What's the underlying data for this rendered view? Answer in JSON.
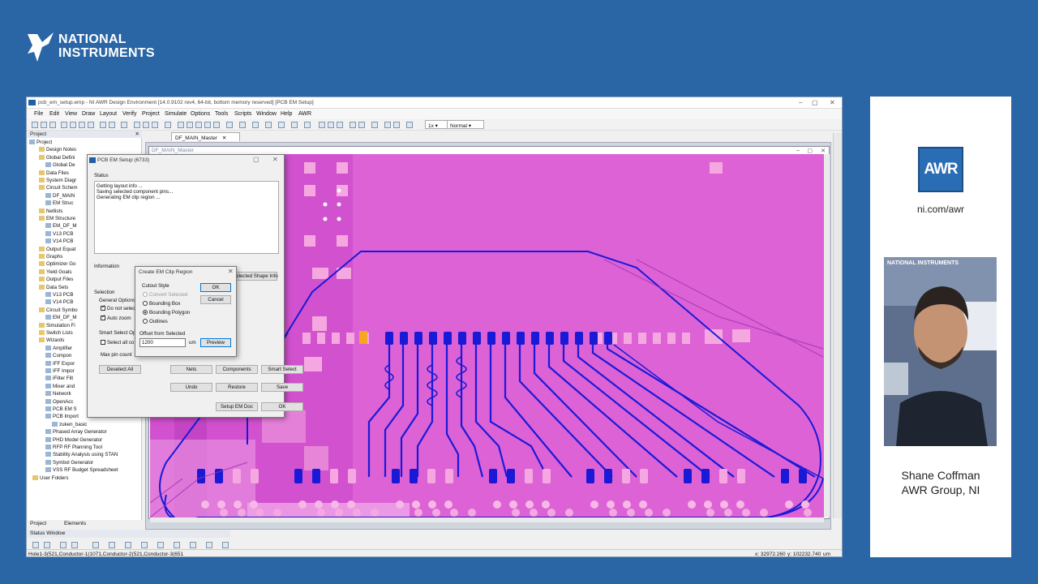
{
  "brand": {
    "line1": "NATIONAL",
    "line2": "INSTRUMENTS"
  },
  "window": {
    "title": "pcb_em_setup.emp - NI AWR Design Environment [14.0.9102 rev4, 64-bit, bottom memory reserved] [PCB EM Setup]",
    "controls": [
      "–",
      "▢",
      "✕"
    ]
  },
  "menu": [
    "File",
    "Edit",
    "View",
    "Draw",
    "Layout",
    "Verify",
    "Project",
    "Simulate",
    "Options",
    "Tools",
    "Scripts",
    "Window",
    "Help",
    "AWR"
  ],
  "toolbar": {
    "zoom": "1x",
    "mode": "Normal"
  },
  "project_pane": {
    "title": "Project",
    "items": [
      {
        "label": "Project",
        "icon": "d"
      },
      {
        "label": "Design Notes",
        "icon": "f"
      },
      {
        "label": "Global Defini",
        "icon": "f"
      },
      {
        "label": "Global De",
        "icon": "d"
      },
      {
        "label": "Data Files",
        "icon": "f"
      },
      {
        "label": "System Diagr",
        "icon": "f"
      },
      {
        "label": "Circuit Schem",
        "icon": "f"
      },
      {
        "label": "DF_MAIN",
        "icon": "d"
      },
      {
        "label": "EM Struc",
        "icon": "d"
      },
      {
        "label": "Netlists",
        "icon": "f"
      },
      {
        "label": "EM Structure",
        "icon": "f"
      },
      {
        "label": "EM_DF_M",
        "icon": "d"
      },
      {
        "label": "V13 PCB",
        "icon": "d"
      },
      {
        "label": "V14 PCB",
        "icon": "d"
      },
      {
        "label": "Output Equat",
        "icon": "f"
      },
      {
        "label": "Graphs",
        "icon": "f"
      },
      {
        "label": "Optimizer Go",
        "icon": "f"
      },
      {
        "label": "Yield Goals",
        "icon": "f"
      },
      {
        "label": "Output Files",
        "icon": "f"
      },
      {
        "label": "Data Sets",
        "icon": "f"
      },
      {
        "label": "V13 PCB",
        "icon": "d"
      },
      {
        "label": "V14 PCB",
        "icon": "d"
      },
      {
        "label": "Circuit Symbo",
        "icon": "f"
      },
      {
        "label": "EM_DF_M",
        "icon": "d"
      },
      {
        "label": "Simulation Fi",
        "icon": "f"
      },
      {
        "label": "Switch Lists",
        "icon": "f"
      },
      {
        "label": "Wizards",
        "icon": "f"
      },
      {
        "label": "Amplifier",
        "icon": "d"
      },
      {
        "label": "Compon",
        "icon": "d"
      },
      {
        "label": "IFF Expor",
        "icon": "d"
      },
      {
        "label": "IFF Impor",
        "icon": "d"
      },
      {
        "label": "iFilter Filt",
        "icon": "d"
      },
      {
        "label": "Mixer and",
        "icon": "d"
      },
      {
        "label": "Network",
        "icon": "d"
      },
      {
        "label": "OpenAcc",
        "icon": "d"
      },
      {
        "label": "PCB EM S",
        "icon": "d"
      },
      {
        "label": "PCB Import",
        "icon": "d"
      },
      {
        "label": "zuken_basic",
        "icon": "d"
      },
      {
        "label": "Phased Array Generator",
        "icon": "d"
      },
      {
        "label": "PHD Model Generator",
        "icon": "d"
      },
      {
        "label": "RFP RF Planning Tool",
        "icon": "d"
      },
      {
        "label": "Stability Analysis using STAN",
        "icon": "d"
      },
      {
        "label": "Symbol Generator",
        "icon": "d"
      },
      {
        "label": "VSS RF Budget Spreadsheet",
        "icon": "d"
      },
      {
        "label": "User Folders",
        "icon": "f"
      }
    ],
    "tabs": [
      "Project",
      "Elements"
    ]
  },
  "status_window": {
    "title": "Status Window"
  },
  "statusbar": {
    "left": "Hole1-3(521,Conductor-1(1071,Conductor-2(521,Conductor-3(651",
    "x": "x: 32972.260",
    "y": "y: 102232.740",
    "unit": "um"
  },
  "layout": {
    "tab": "DF_MAIN_Master",
    "inner_title": "DF_MAIN_Master"
  },
  "pcb_em_setup": {
    "title": "PCB EM Setup (6733)",
    "status_label": "Status",
    "status_lines": [
      "Getting layout info ...",
      "Saving selected component pins...",
      "Generating EM clip region ..."
    ],
    "information_label": "Information",
    "shape_info_button": "Selected Shape Info",
    "selection_label": "Selection",
    "general_options_label": "General Options",
    "do_not_select": "Do not select",
    "auto_zoom": "Auto zoom",
    "smart_select_label": "Smart Select Optio",
    "select_all": "Select all co",
    "max_pin_count": "Max pin count",
    "buttons_row1": [
      "Deselect All",
      "Nets",
      "Components",
      "Smart Select"
    ],
    "buttons_row2": [
      "Undo",
      "Restore",
      "Save"
    ],
    "setup_em_doc": "Setup EM Doc",
    "ok": "OK"
  },
  "clip_dialog": {
    "title": "Create EM Clip Region",
    "cutout_style_label": "Cutout Style",
    "options": [
      "Convert Selected",
      "Bounding Box",
      "Bounding Polygon",
      "Outlines"
    ],
    "selected": "Bounding Polygon",
    "offset_label": "Offset from Selected",
    "offset_value": "1200",
    "unit": "um",
    "ok": "OK",
    "cancel": "Cancel",
    "preview": "Preview"
  },
  "right_panel": {
    "logo": "AWR",
    "url": "ni.com/awr",
    "presenter_name": "Shane Coffman",
    "presenter_org": "AWR Group, NI",
    "backdrop_brand": "NATIONAL INSTRUMENTS"
  },
  "colors": {
    "background": "#2a66a6",
    "pcb": "#dc62d6",
    "trace": "#1a1ad6",
    "pad": "#f5a8e0"
  }
}
